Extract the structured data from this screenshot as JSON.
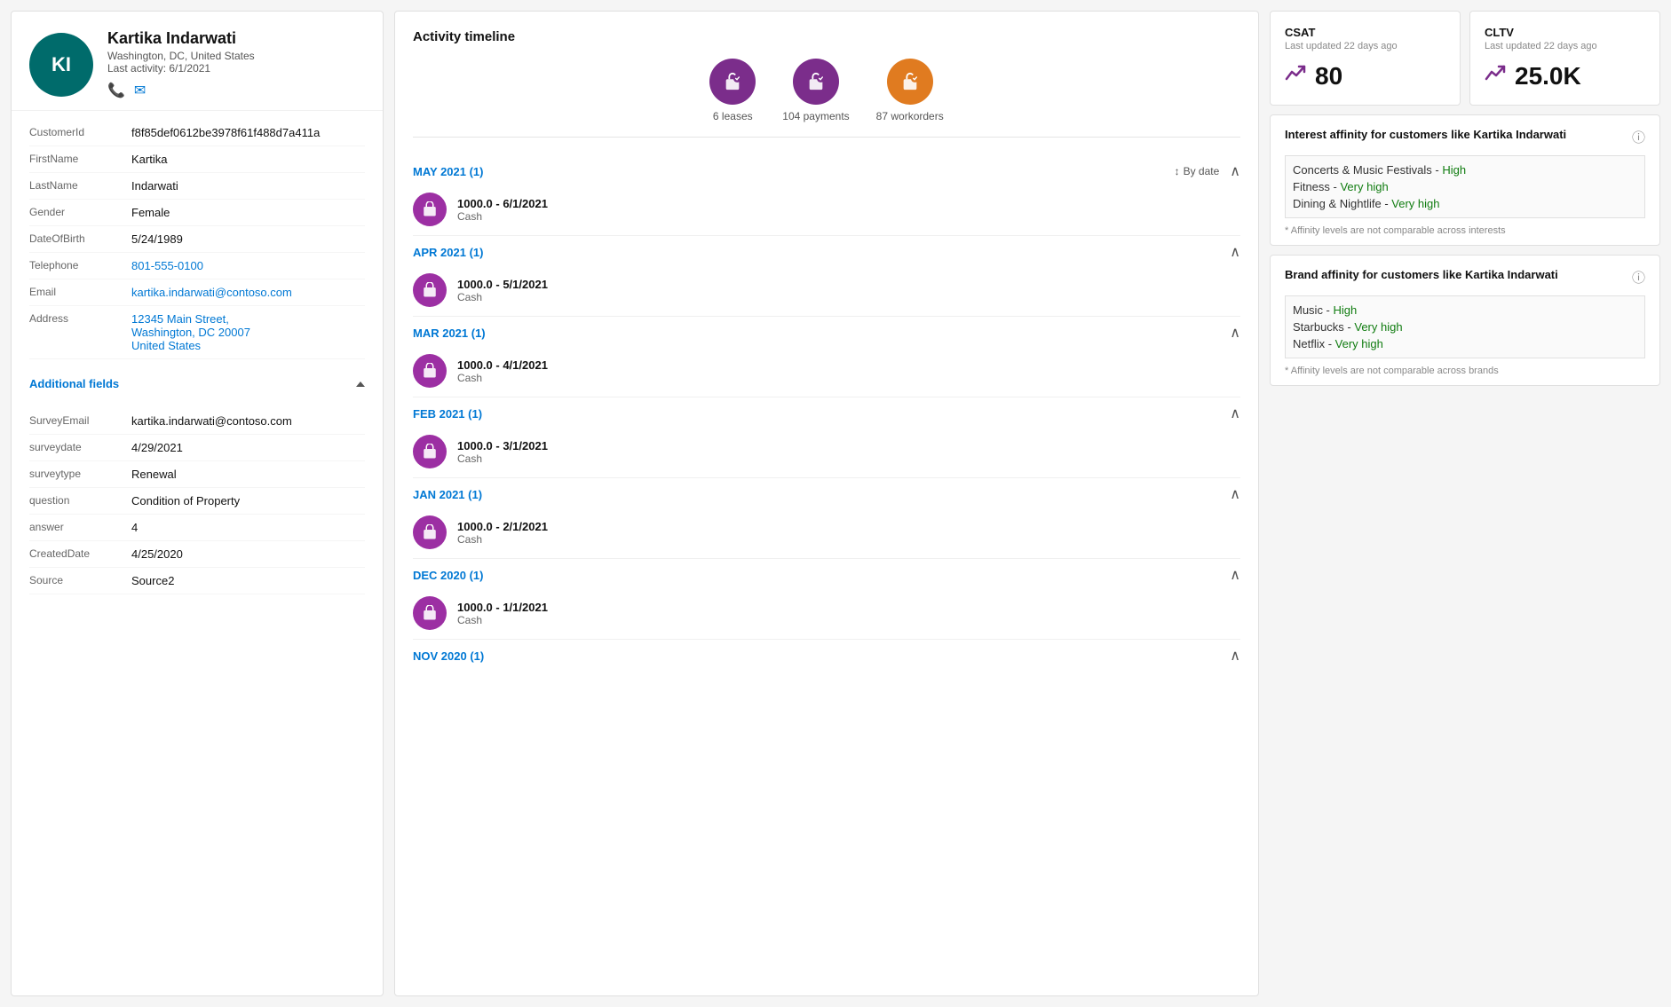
{
  "profile": {
    "initials": "KI",
    "name": "Kartika Indarwati",
    "location": "Washington, DC, United States",
    "last_activity_label": "Last activity:",
    "last_activity_date": "6/1/2021",
    "avatar_bg": "#006b6b"
  },
  "fields": [
    {
      "label": "CustomerId",
      "value": "f8f85def0612be3978f61f488d7a411a",
      "link": false
    },
    {
      "label": "FirstName",
      "value": "Kartika",
      "link": false
    },
    {
      "label": "LastName",
      "value": "Indarwati",
      "link": false
    },
    {
      "label": "Gender",
      "value": "Female",
      "link": false
    },
    {
      "label": "DateOfBirth",
      "value": "5/24/1989",
      "link": false
    },
    {
      "label": "Telephone",
      "value": "801-555-0100",
      "link": true
    },
    {
      "label": "Email",
      "value": "kartika.indarwati@contoso.com",
      "link": true
    },
    {
      "label": "Address",
      "value": "12345 Main Street,\nWashington, DC 20007\nUnited States",
      "link": true
    }
  ],
  "additional_fields_label": "Additional fields",
  "additional_fields": [
    {
      "label": "SurveyEmail",
      "value": "kartika.indarwati@contoso.com",
      "link": false
    },
    {
      "label": "surveydate",
      "value": "4/29/2021",
      "link": false
    },
    {
      "label": "surveytype",
      "value": "Renewal",
      "link": false
    },
    {
      "label": "question",
      "value": "Condition of Property",
      "link": false
    },
    {
      "label": "answer",
      "value": "4",
      "link": false
    },
    {
      "label": "CreatedDate",
      "value": "4/25/2020",
      "link": false
    },
    {
      "label": "Source",
      "value": "Source2",
      "link": false
    }
  ],
  "activity": {
    "title": "Activity timeline",
    "icons": [
      {
        "label": "6 leases",
        "color": "purple",
        "icon": "🛍"
      },
      {
        "label": "104 payments",
        "color": "purple",
        "icon": "🛍"
      },
      {
        "label": "87 workorders",
        "color": "orange",
        "icon": "🛍"
      }
    ],
    "sort_label": "By date",
    "sections": [
      {
        "month": "MAY 2021 (1)",
        "entries": [
          {
            "amount_date": "1000.0 - 6/1/2021",
            "type": "Cash"
          }
        ]
      },
      {
        "month": "APR 2021 (1)",
        "entries": [
          {
            "amount_date": "1000.0 - 5/1/2021",
            "type": "Cash"
          }
        ]
      },
      {
        "month": "MAR 2021 (1)",
        "entries": [
          {
            "amount_date": "1000.0 - 4/1/2021",
            "type": "Cash"
          }
        ]
      },
      {
        "month": "FEB 2021 (1)",
        "entries": [
          {
            "amount_date": "1000.0 - 3/1/2021",
            "type": "Cash"
          }
        ]
      },
      {
        "month": "JAN 2021 (1)",
        "entries": [
          {
            "amount_date": "1000.0 - 2/1/2021",
            "type": "Cash"
          }
        ]
      },
      {
        "month": "DEC 2020 (1)",
        "entries": [
          {
            "amount_date": "1000.0 - 1/1/2021",
            "type": "Cash"
          }
        ]
      },
      {
        "month": "NOV 2020 (1)",
        "entries": []
      }
    ]
  },
  "csat": {
    "title": "CSAT",
    "subtitle": "Last updated 22 days ago",
    "value": "80"
  },
  "cltv": {
    "title": "CLTV",
    "subtitle": "Last updated 22 days ago",
    "value": "25.0K"
  },
  "interest_affinity": {
    "title": "Interest affinity for customers like Kartika Indarwati",
    "items": [
      {
        "name": "Concerts & Music Festivals",
        "separator": " - ",
        "level": "High",
        "level_class": "level-high"
      },
      {
        "name": "Fitness",
        "separator": " - ",
        "level": "Very high",
        "level_class": "level-very-high"
      },
      {
        "name": "Dining & Nightlife",
        "separator": " - ",
        "level": "Very high",
        "level_class": "level-very-high"
      }
    ],
    "note": "* Affinity levels are not comparable across interests"
  },
  "brand_affinity": {
    "title": "Brand affinity for customers like Kartika Indarwati",
    "items": [
      {
        "name": "Music",
        "separator": " - ",
        "level": "High",
        "level_class": "level-high"
      },
      {
        "name": "Starbucks",
        "separator": " - ",
        "level": "Very high",
        "level_class": "level-very-high"
      },
      {
        "name": "Netflix",
        "separator": " - ",
        "level": "Very high",
        "level_class": "level-very-high"
      }
    ],
    "note": "* Affinity levels are not comparable across brands"
  },
  "icons": {
    "phone": "📞",
    "email": "✉",
    "sort": "↕",
    "chevron_up": "∧",
    "info": "ℹ",
    "trend": "📈"
  }
}
